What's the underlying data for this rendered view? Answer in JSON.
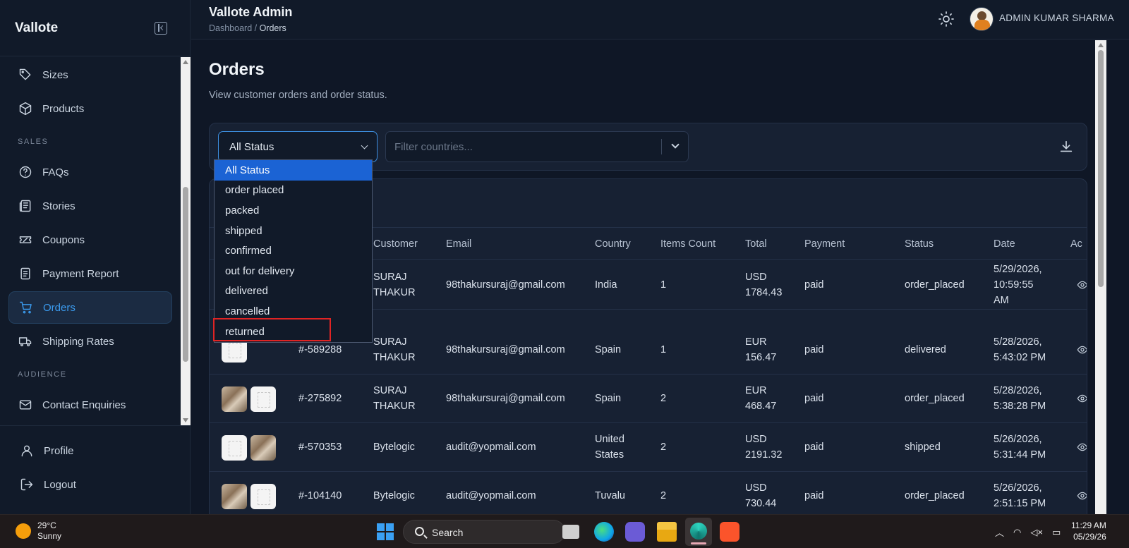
{
  "sidebar": {
    "brand": "Vallote",
    "items_top": [
      {
        "label": "Sizes",
        "icon": "tag-icon"
      },
      {
        "label": "Products",
        "icon": "box-icon"
      }
    ],
    "section_sales": "SALES",
    "items_sales": [
      {
        "label": "FAQs",
        "icon": "help-circle-icon"
      },
      {
        "label": "Stories",
        "icon": "newspaper-icon"
      },
      {
        "label": "Coupons",
        "icon": "ticket-icon"
      },
      {
        "label": "Payment Report",
        "icon": "file-text-icon"
      },
      {
        "label": "Orders",
        "icon": "cart-icon",
        "active": true
      },
      {
        "label": "Shipping Rates",
        "icon": "truck-icon"
      }
    ],
    "section_audience": "AUDIENCE",
    "items_audience": [
      {
        "label": "Contact Enquiries",
        "icon": "mail-icon"
      }
    ],
    "bottom": [
      {
        "label": "Profile",
        "icon": "user-icon"
      },
      {
        "label": "Logout",
        "icon": "logout-icon"
      }
    ]
  },
  "header": {
    "title": "Vallote Admin",
    "breadcrumb_root": "Dashboard",
    "breadcrumb_sep": " / ",
    "breadcrumb_current": "Orders",
    "user_name": "ADMIN KUMAR SHARMA"
  },
  "page": {
    "title": "Orders",
    "subtitle": "View customer orders and order status."
  },
  "filters": {
    "status_value": "All Status",
    "country_placeholder": "Filter countries...",
    "status_options": [
      "All Status",
      "order placed",
      "packed",
      "shipped",
      "confirmed",
      "out for delivery",
      "delivered",
      "cancelled",
      "returned"
    ],
    "highlighted_option": "returned"
  },
  "table": {
    "headers": {
      "customer": "Customer",
      "email": "Email",
      "country": "Country",
      "items": "Items Count",
      "total": "Total",
      "payment": "Payment",
      "status": "Status",
      "date": "Date",
      "actions": "Ac"
    },
    "rows": [
      {
        "id": "",
        "cust1": "SURAJ",
        "cust2": "THAKUR",
        "email": "98thakursuraj@gmail.com",
        "country1": "India",
        "country2": "",
        "items": "1",
        "cur": "USD",
        "amt": "1784.43",
        "payment": "paid",
        "status": "order_placed",
        "d1": "5/29/2026,",
        "d2": "10:59:55",
        "d3": "AM"
      },
      {
        "id": "#-589288",
        "cust1": "SURAJ",
        "cust2": "THAKUR",
        "email": "98thakursuraj@gmail.com",
        "country1": "Spain",
        "country2": "",
        "items": "1",
        "cur": "EUR",
        "amt": "156.47",
        "payment": "paid",
        "status": "delivered",
        "d1": "5/28/2026,",
        "d2": "5:43:02 PM",
        "d3": ""
      },
      {
        "id": "#-275892",
        "cust1": "SURAJ",
        "cust2": "THAKUR",
        "email": "98thakursuraj@gmail.com",
        "country1": "Spain",
        "country2": "",
        "items": "2",
        "cur": "EUR",
        "amt": "468.47",
        "payment": "paid",
        "status": "order_placed",
        "d1": "5/28/2026,",
        "d2": "5:38:28 PM",
        "d3": ""
      },
      {
        "id": "#-570353",
        "cust1": "Bytelogic",
        "cust2": "",
        "email": "audit@yopmail.com",
        "country1": "United",
        "country2": "States",
        "items": "2",
        "cur": "USD",
        "amt": "2191.32",
        "payment": "paid",
        "status": "shipped",
        "d1": "5/26/2026,",
        "d2": "5:31:44 PM",
        "d3": ""
      },
      {
        "id": "#-104140",
        "cust1": "Bytelogic",
        "cust2": "",
        "email": "audit@yopmail.com",
        "country1": "Tuvalu",
        "country2": "",
        "items": "2",
        "cur": "USD",
        "amt": "730.44",
        "payment": "paid",
        "status": "order_placed",
        "d1": "5/26/2026,",
        "d2": "2:51:15 PM",
        "d3": ""
      }
    ]
  },
  "taskbar": {
    "temp": "29°C",
    "weather": "Sunny",
    "search": "Search",
    "time": "11:29 AM",
    "date": "05/29/26"
  }
}
